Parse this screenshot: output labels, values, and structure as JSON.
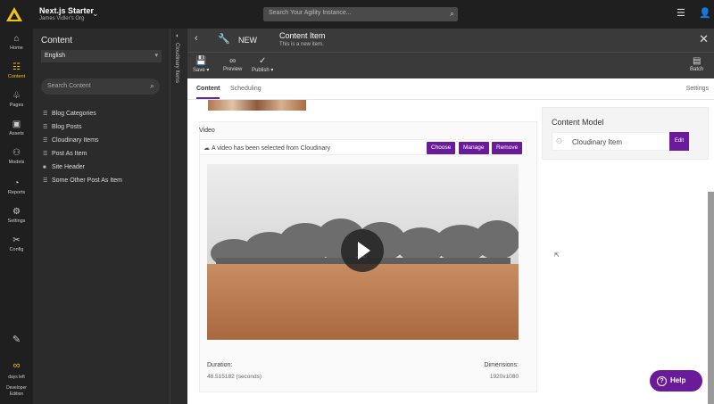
{
  "topbar": {
    "org_title": "Next.js Starter",
    "org_subtitle": "James Vidler's Org",
    "search_placeholder": "Search Your Agility Instance..."
  },
  "leftnav": {
    "items": [
      {
        "label": "Home",
        "icon": "home-icon"
      },
      {
        "label": "Content",
        "icon": "content-icon"
      },
      {
        "label": "Pages",
        "icon": "pages-icon"
      },
      {
        "label": "Assets",
        "icon": "assets-icon"
      },
      {
        "label": "Models",
        "icon": "models-icon"
      },
      {
        "label": "Reports",
        "icon": "reports-icon"
      },
      {
        "label": "Settings",
        "icon": "settings-icon"
      },
      {
        "label": "Config",
        "icon": "config-icon"
      }
    ],
    "days_left_label": "days left",
    "edition_label": "Developer Edition"
  },
  "tree": {
    "title": "Content",
    "language": "English",
    "search_placeholder": "Search Content",
    "items": [
      {
        "label": "Blog Categories",
        "icon": "list-icon"
      },
      {
        "label": "Blog Posts",
        "icon": "list-icon"
      },
      {
        "label": "Cloudinary Items",
        "icon": "list-icon"
      },
      {
        "label": "Post As Item",
        "icon": "list-icon"
      },
      {
        "label": "Site Header",
        "icon": "item-icon"
      },
      {
        "label": "Some Other Post As Item",
        "icon": "list-icon"
      }
    ]
  },
  "side_strip": {
    "label": "Cloudinary Items"
  },
  "content_item": {
    "new_label": "NEW",
    "title": "Content Item",
    "subtitle": "This is a new item."
  },
  "toolbar": {
    "save_label": "Save",
    "preview_label": "Preview",
    "publish_label": "Publish",
    "batch_label": "Batch"
  },
  "tabs": {
    "content": "Content",
    "scheduling": "Scheduling",
    "settings": "Settings"
  },
  "video_field": {
    "label": "Video",
    "message": "A video has been selected from Cloudinary",
    "choose_label": "Choose",
    "manage_label": "Manage",
    "remove_label": "Remove",
    "duration_label": "Duration:",
    "duration_value": "48.515182 (seconds)",
    "dimensions_label": "Dimensions:",
    "dimensions_value": "1920x1080"
  },
  "content_model": {
    "title": "Content Model",
    "item_label": "Cloudinary Item",
    "edit_label": "Edit"
  },
  "help": {
    "label": "Help"
  },
  "colors": {
    "accent": "#6a1b9a",
    "brand_yellow": "#f0c419",
    "dark_bg": "#1f1f1f"
  }
}
